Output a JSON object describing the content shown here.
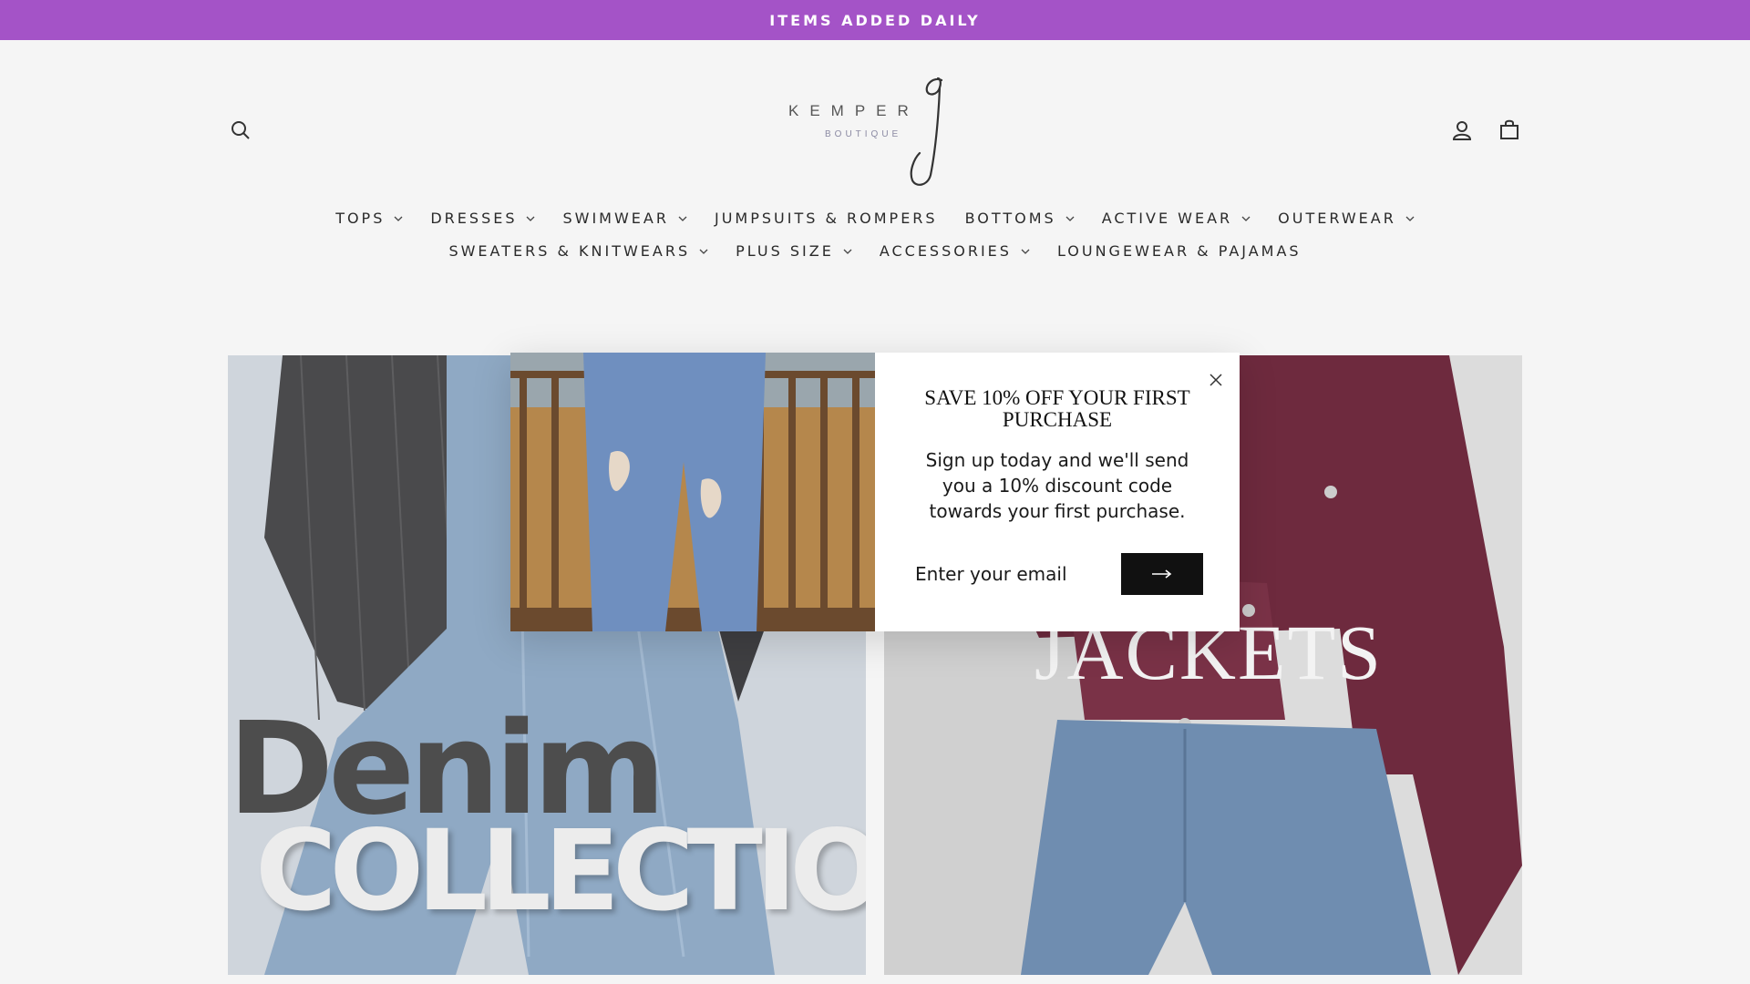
{
  "announcement": {
    "text": "ITEMS ADDED DAILY"
  },
  "header": {
    "logo": {
      "brand": "KEMPER",
      "subtitle": "BOUTIQUE"
    },
    "search_icon": "search-icon",
    "account_icon": "account-icon",
    "cart_icon": "cart-icon"
  },
  "nav": {
    "row1": [
      {
        "label": "TOPS",
        "dropdown": true
      },
      {
        "label": "DRESSES",
        "dropdown": true
      },
      {
        "label": "SWIMWEAR",
        "dropdown": true
      },
      {
        "label": "JUMPSUITS & ROMPERS",
        "dropdown": false
      },
      {
        "label": "BOTTOMS",
        "dropdown": true
      },
      {
        "label": "ACTIVE WEAR",
        "dropdown": true
      },
      {
        "label": "OUTERWEAR",
        "dropdown": true
      }
    ],
    "row2": [
      {
        "label": "SWEATERS & KNITWEARS",
        "dropdown": true
      },
      {
        "label": "PLUS SIZE",
        "dropdown": true
      },
      {
        "label": "ACCESSORIES",
        "dropdown": true
      },
      {
        "label": "LOUNGEWEAR & PAJAMAS",
        "dropdown": false
      }
    ]
  },
  "collections": {
    "left": {
      "line1": "Denim",
      "line2": "COLLECTION"
    },
    "right": {
      "title": "JACKETS"
    }
  },
  "popup": {
    "title": "SAVE 10% OFF YOUR FIRST PURCHASE",
    "body": "Sign up today and we'll send you a 10% discount code towards your first purchase.",
    "email_placeholder": "Enter your email",
    "submit_icon": "arrow-right-icon",
    "close_icon": "close-icon"
  },
  "colors": {
    "announcement_bg": "#a453c7",
    "page_bg": "#f5f5f5",
    "button_bg": "#111111",
    "jacket": "#6e2a3e",
    "denim": "#7f9fc4"
  }
}
